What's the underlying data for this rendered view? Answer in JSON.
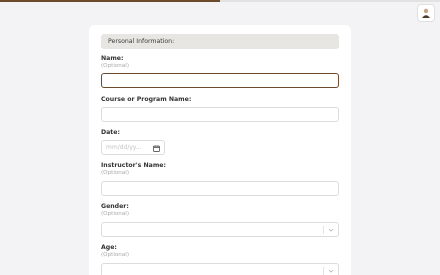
{
  "progress": {
    "fraction": 0.5,
    "color": "#6b4b2a"
  },
  "form": {
    "section_title": "Personal Information:",
    "fields": [
      {
        "label": "Name:",
        "hint": "(Optional)",
        "value": ""
      },
      {
        "label": "Course or Program Name:",
        "value": ""
      },
      {
        "label": "Date:",
        "placeholder": "mm/dd/yy..."
      },
      {
        "label": "Instructor's Name:",
        "hint": "(Optional)",
        "value": ""
      },
      {
        "label": "Gender:",
        "hint": "(Optional)",
        "selected": ""
      },
      {
        "label": "Age:",
        "hint": "(Optional)",
        "selected": ""
      }
    ]
  },
  "icons": {
    "avatar": "user-avatar-icon",
    "calendar": "calendar-icon",
    "chevron": "chevron-down-icon"
  },
  "colors": {
    "accent": "#6b4b2a",
    "section_bg": "#e8e6e2",
    "page_bg": "#f3f3f5"
  }
}
